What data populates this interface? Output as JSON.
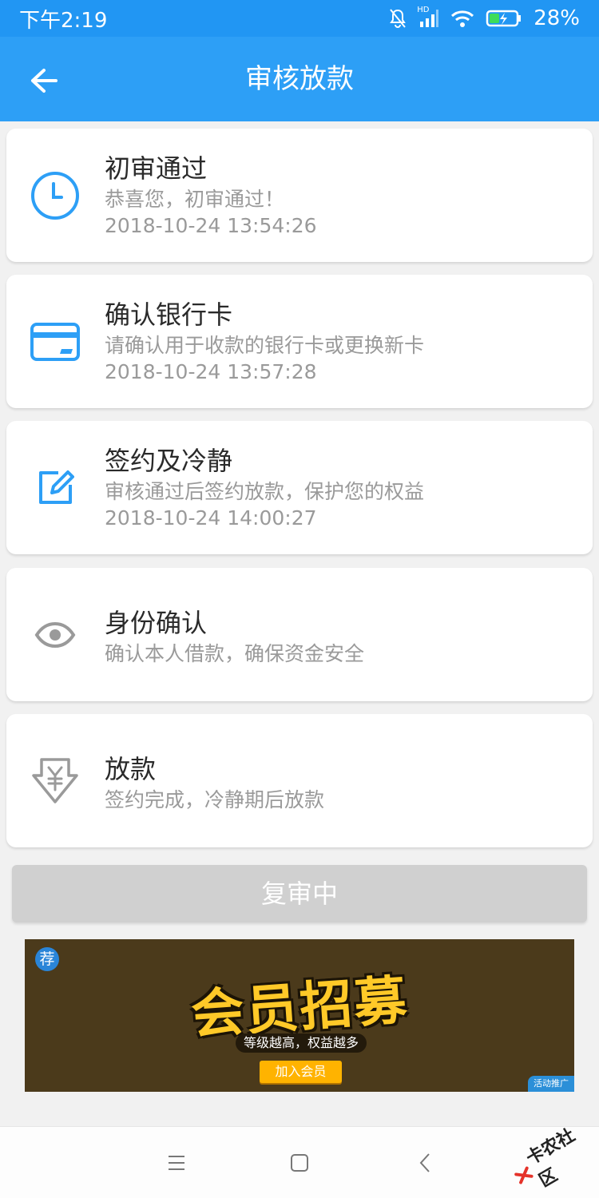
{
  "status_bar": {
    "time": "下午2:19",
    "network": "HD",
    "battery": "28%"
  },
  "app_bar": {
    "title": "审核放款"
  },
  "steps": [
    {
      "title": "初审通过",
      "subtitle": "恭喜您，初审通过！",
      "time": "2018-10-24 13:54:26",
      "icon": "clock-icon",
      "color": "#2d9ff6"
    },
    {
      "title": "确认银行卡",
      "subtitle": "请确认用于收款的银行卡或更换新卡",
      "time": "2018-10-24 13:57:28",
      "icon": "bank-card-icon",
      "color": "#2d9ff6"
    },
    {
      "title": "签约及冷静",
      "subtitle": "审核通过后签约放款，保护您的权益",
      "time": "2018-10-24 14:00:27",
      "icon": "edit-icon",
      "color": "#2d9ff6"
    },
    {
      "title": "身份确认",
      "subtitle": "确认本人借款，确保资金安全",
      "icon": "eye-icon",
      "color": "#9a9a9a"
    },
    {
      "title": "放款",
      "subtitle": "签约完成，冷静期后放款",
      "icon": "yuan-download-icon",
      "color": "#9a9a9a"
    }
  ],
  "review_button": {
    "label": "复审中"
  },
  "banner": {
    "badge": "荐",
    "headline": "会员招募",
    "slogan": "等级越高，权益越多",
    "join_label": "加入会员",
    "tag": "活动推广"
  },
  "watermark": {
    "text": "卡农社区"
  }
}
